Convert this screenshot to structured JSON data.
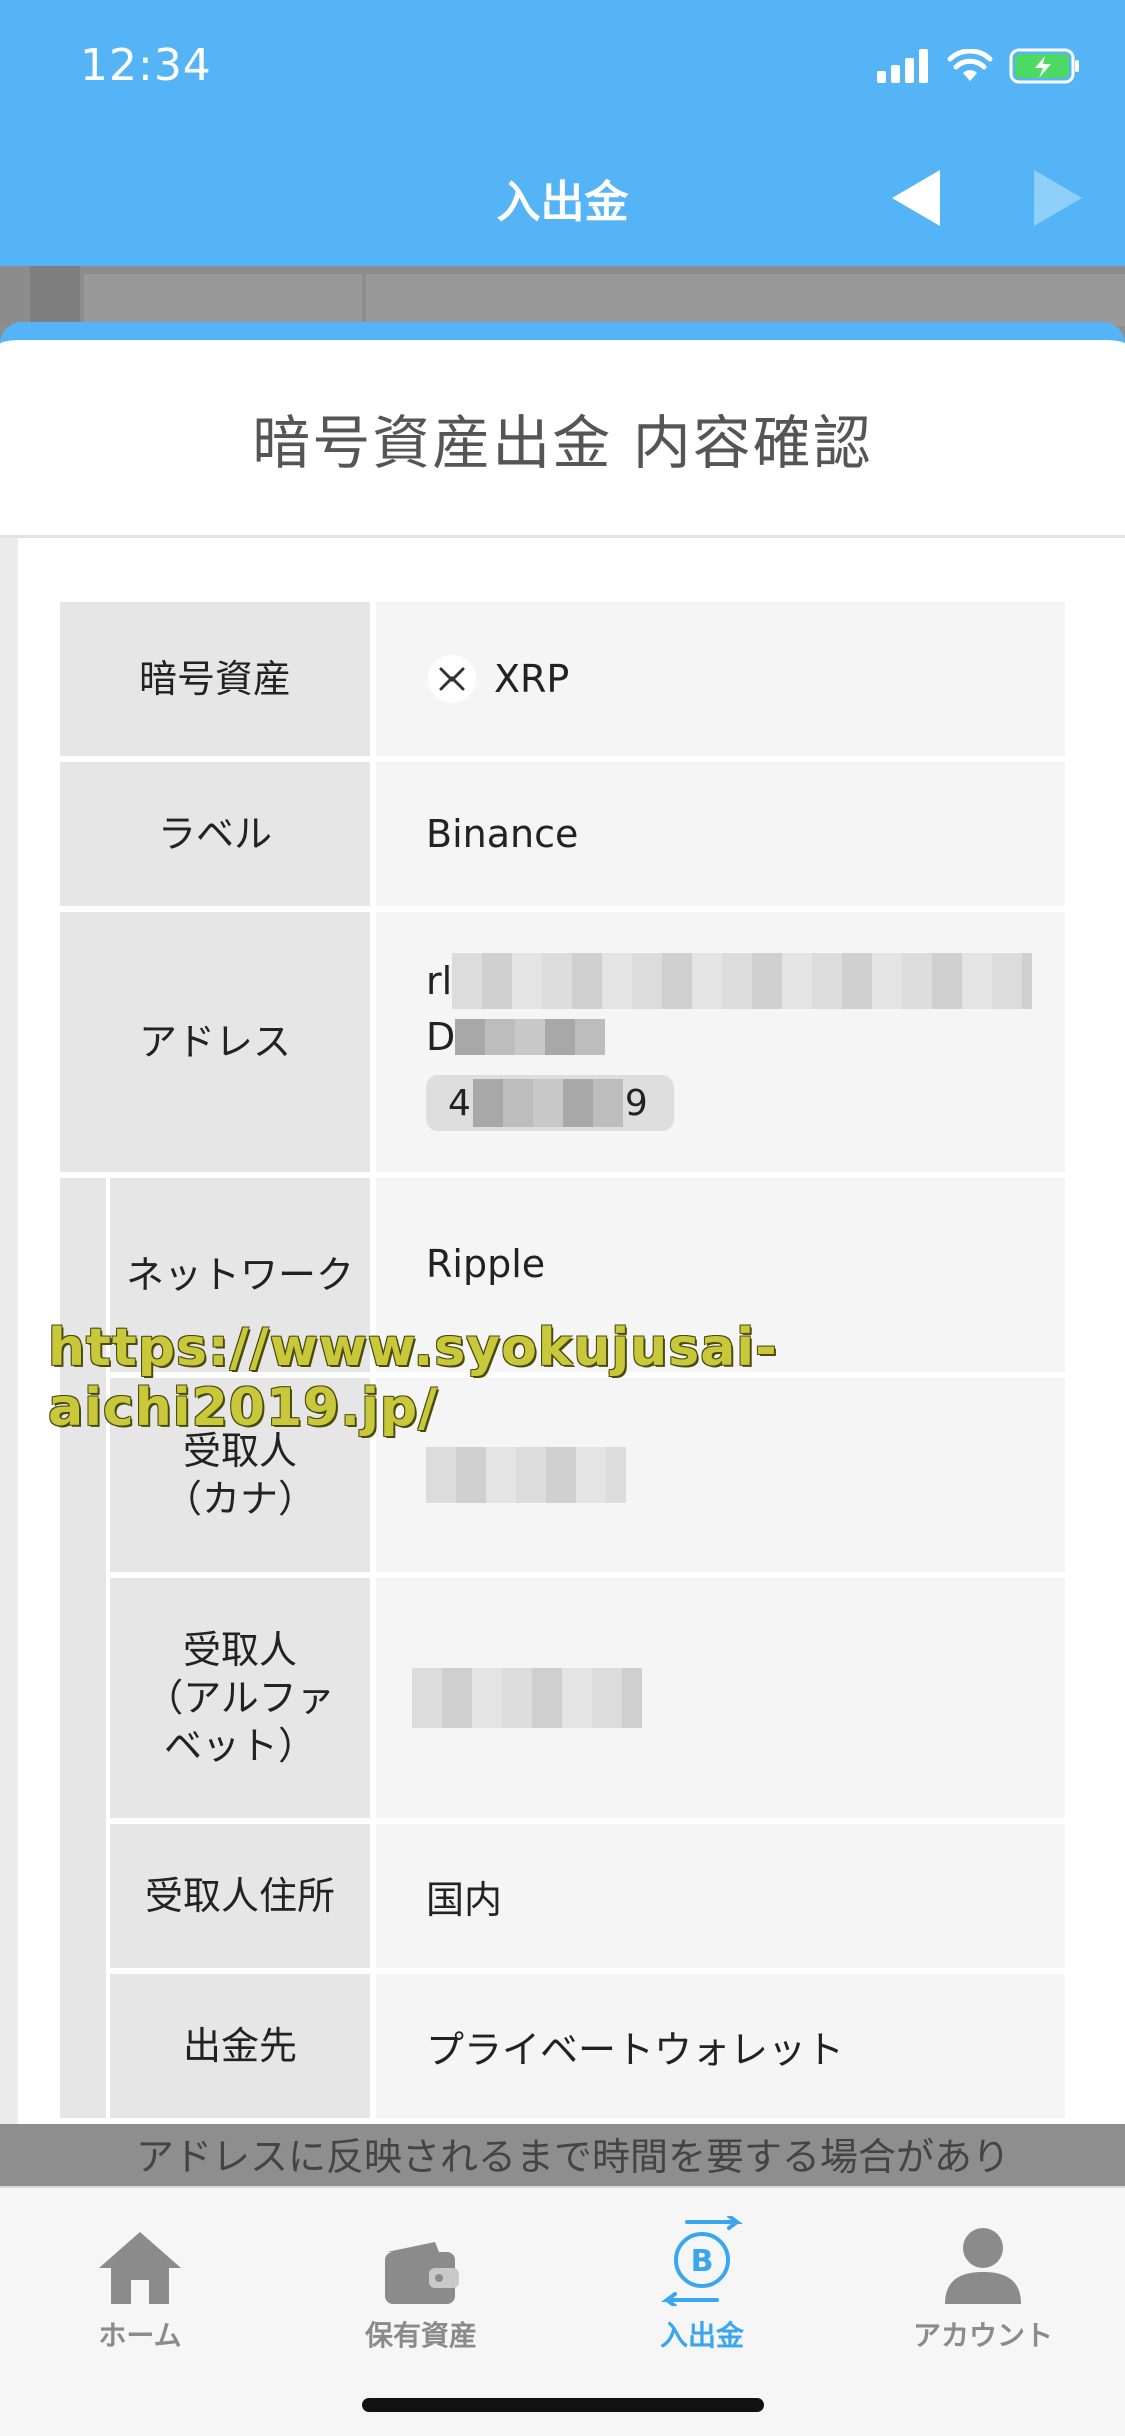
{
  "status_bar": {
    "time": "12:34"
  },
  "nav": {
    "title": "入出金"
  },
  "modal": {
    "title": "暗号資産出金 内容確認",
    "rows": {
      "asset": {
        "label": "暗号資産",
        "value": "XRP"
      },
      "label": {
        "label": "ラベル",
        "value": "Binance"
      },
      "address": {
        "label": "アドレス",
        "line1_prefix": "rl",
        "line2_prefix": "D",
        "tag_prefix": "4",
        "tag_suffix": "9"
      },
      "network": {
        "label": "ネットワーク",
        "value": "Ripple"
      },
      "recipient_kana": {
        "label": "受取人\n（カナ）"
      },
      "recipient_alpha": {
        "label": "受取人\n（アルファ\nベット）"
      },
      "recipient_address": {
        "label": "受取人住所",
        "value": "国内"
      },
      "destination": {
        "label": "出金先",
        "value": "プライベートウォレット"
      }
    }
  },
  "watermark": "https://www.syokujusai-aichi2019.jp/",
  "background_notice": "アドレスに反映されるまで時間を要する場合があり",
  "tabbar": {
    "items": [
      {
        "label": "ホーム",
        "icon": "home-icon"
      },
      {
        "label": "保有資産",
        "icon": "wallet-icon"
      },
      {
        "label": "入出金",
        "icon": "bitcoin-transfer-icon",
        "active": true
      },
      {
        "label": "アカウント",
        "icon": "person-icon"
      }
    ]
  },
  "colors": {
    "accent": "#55b4f6",
    "active_tab": "#3aa6ef",
    "battery": "#4cd964"
  }
}
